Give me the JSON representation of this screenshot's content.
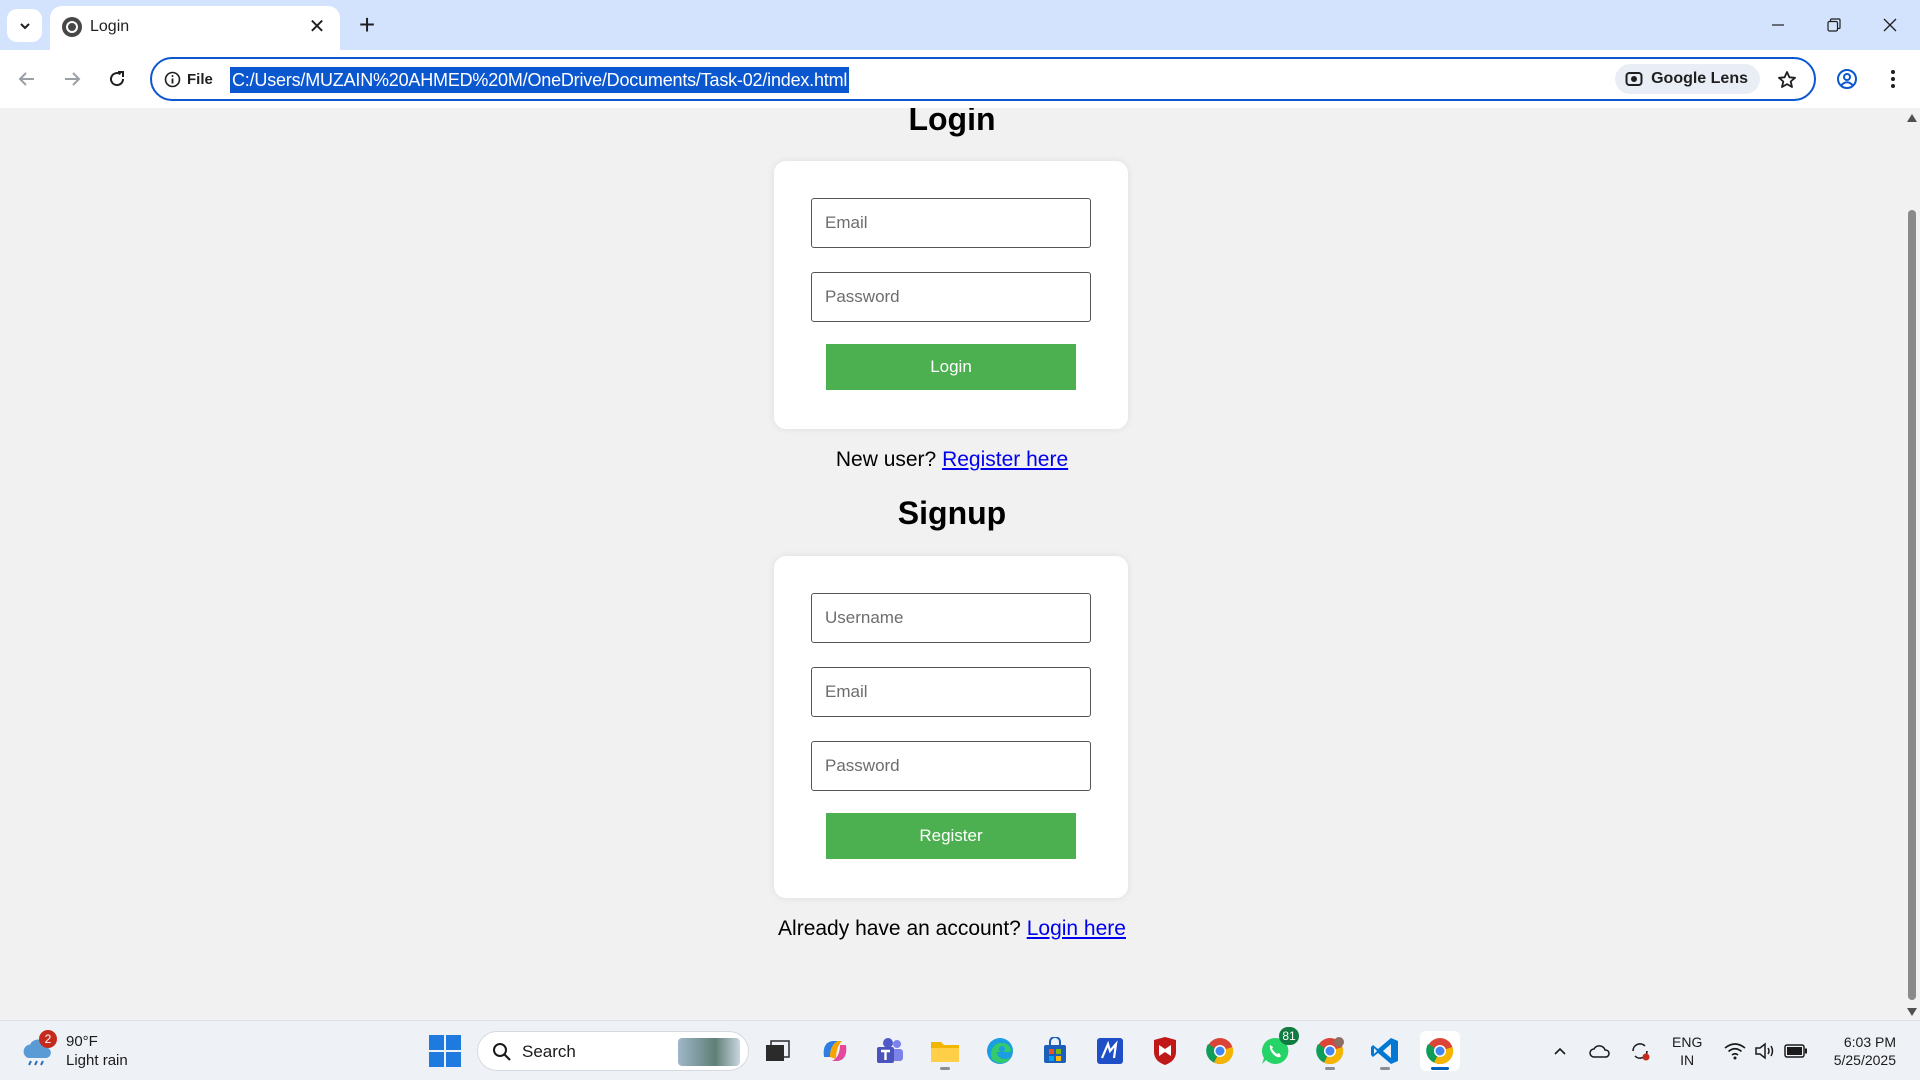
{
  "browser": {
    "tab_title": "Login",
    "site_chip_label": "File",
    "url": "C:/Users/MUZAIN%20AHMED%20M/OneDrive/Documents/Task-02/index.html",
    "lens_label": "Google Lens"
  },
  "login": {
    "heading": "Login",
    "email_placeholder": "Email",
    "password_placeholder": "Password",
    "button_label": "Login",
    "switch_prompt": "New user?",
    "switch_link": "Register here"
  },
  "signup": {
    "heading": "Signup",
    "username_placeholder": "Username",
    "email_placeholder": "Email",
    "password_placeholder": "Password",
    "button_label": "Register",
    "switch_prompt": "Already have an account?",
    "switch_link": "Login here"
  },
  "taskbar": {
    "weather_temp": "90°F",
    "weather_desc": "Light rain",
    "weather_badge": "2",
    "search_label": "Search",
    "whatsapp_badge": "81",
    "lang_primary": "ENG",
    "lang_secondary": "IN",
    "time": "6:03 PM",
    "date": "5/25/2025"
  },
  "colors": {
    "button_green": "#4caf50",
    "link_blue": "#0000ee",
    "omnibox_accent": "#0b57d0",
    "tabstrip_bg": "#d3e3fd"
  }
}
